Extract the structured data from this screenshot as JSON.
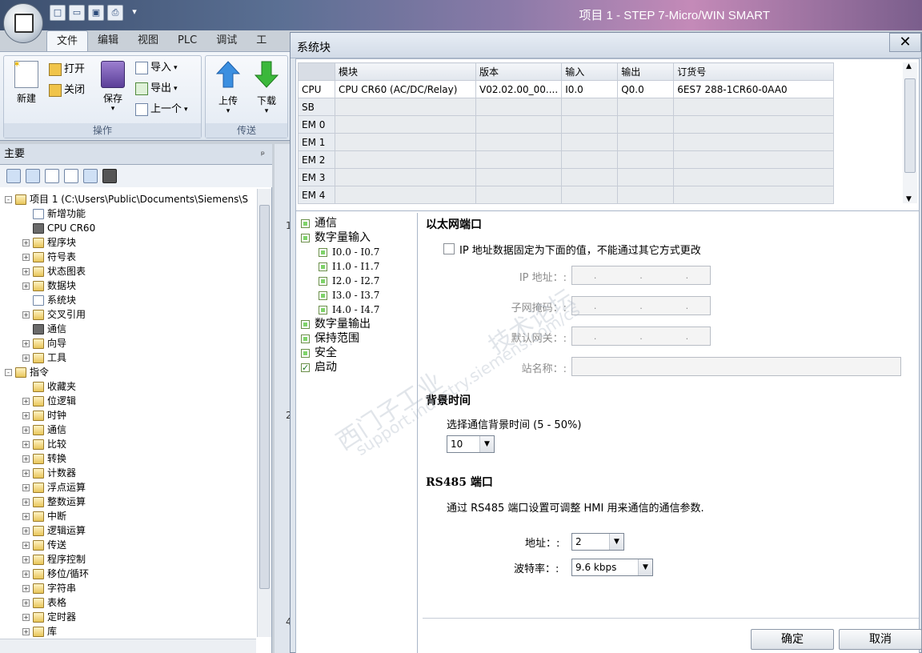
{
  "window": {
    "title": "项目 1 - STEP 7-Micro/WIN SMART"
  },
  "ribbon": {
    "tabs": [
      "文件",
      "编辑",
      "视图",
      "PLC",
      "调试",
      "工"
    ],
    "active_tab": "文件",
    "group_ops": {
      "label": "操作",
      "new": "新建",
      "open": "打开",
      "close": "关闭",
      "save": "保存",
      "import": "导入",
      "export": "导出",
      "previous": "上一个"
    },
    "group_transfer": {
      "label": "传送",
      "upload": "上传",
      "download": "下载"
    }
  },
  "left_panel": {
    "header": "主要",
    "pin": "ᵖ",
    "tree": [
      {
        "label": "项目 1 (C:\\Users\\Public\\Documents\\Siemens\\S",
        "level": 0,
        "exp": "-"
      },
      {
        "label": "新增功能",
        "level": 1,
        "exp": ""
      },
      {
        "label": "CPU CR60",
        "level": 1,
        "exp": ""
      },
      {
        "label": "程序块",
        "level": 1,
        "exp": "+"
      },
      {
        "label": "符号表",
        "level": 1,
        "exp": "+"
      },
      {
        "label": "状态图表",
        "level": 1,
        "exp": "+"
      },
      {
        "label": "数据块",
        "level": 1,
        "exp": "+"
      },
      {
        "label": "系统块",
        "level": 1,
        "exp": ""
      },
      {
        "label": "交叉引用",
        "level": 1,
        "exp": "+"
      },
      {
        "label": "通信",
        "level": 1,
        "exp": ""
      },
      {
        "label": "向导",
        "level": 1,
        "exp": "+"
      },
      {
        "label": "工具",
        "level": 1,
        "exp": "+"
      },
      {
        "label": "指令",
        "level": 0,
        "exp": "-"
      },
      {
        "label": "收藏夹",
        "level": 1,
        "exp": ""
      },
      {
        "label": "位逻辑",
        "level": 1,
        "exp": "+"
      },
      {
        "label": "时钟",
        "level": 1,
        "exp": "+"
      },
      {
        "label": "通信",
        "level": 1,
        "exp": "+"
      },
      {
        "label": "比较",
        "level": 1,
        "exp": "+"
      },
      {
        "label": "转换",
        "level": 1,
        "exp": "+"
      },
      {
        "label": "计数器",
        "level": 1,
        "exp": "+"
      },
      {
        "label": "浮点运算",
        "level": 1,
        "exp": "+"
      },
      {
        "label": "整数运算",
        "level": 1,
        "exp": "+"
      },
      {
        "label": "中断",
        "level": 1,
        "exp": "+"
      },
      {
        "label": "逻辑运算",
        "level": 1,
        "exp": "+"
      },
      {
        "label": "传送",
        "level": 1,
        "exp": "+"
      },
      {
        "label": "程序控制",
        "level": 1,
        "exp": "+"
      },
      {
        "label": "移位/循环",
        "level": 1,
        "exp": "+"
      },
      {
        "label": "字符串",
        "level": 1,
        "exp": "+"
      },
      {
        "label": "表格",
        "level": 1,
        "exp": "+"
      },
      {
        "label": "定时器",
        "level": 1,
        "exp": "+"
      },
      {
        "label": "库",
        "level": 1,
        "exp": "+"
      }
    ]
  },
  "editor": {
    "line_numbers": [
      "1",
      "2",
      "4"
    ]
  },
  "dialog": {
    "title": "系统块",
    "close": "✕",
    "table": {
      "columns": [
        "模块",
        "版本",
        "输入",
        "输出",
        "订货号"
      ],
      "rows": [
        {
          "slot": "CPU",
          "module": "CPU CR60 (AC/DC/Relay)",
          "version": "V02.02.00_00....",
          "input": "I0.0",
          "output": "Q0.0",
          "order": "6ES7 288-1CR60-0AA0"
        },
        {
          "slot": "SB",
          "module": "",
          "version": "",
          "input": "",
          "output": "",
          "order": ""
        },
        {
          "slot": "EM 0",
          "module": "",
          "version": "",
          "input": "",
          "output": "",
          "order": ""
        },
        {
          "slot": "EM 1",
          "module": "",
          "version": "",
          "input": "",
          "output": "",
          "order": ""
        },
        {
          "slot": "EM 2",
          "module": "",
          "version": "",
          "input": "",
          "output": "",
          "order": ""
        },
        {
          "slot": "EM 3",
          "module": "",
          "version": "",
          "input": "",
          "output": "",
          "order": ""
        },
        {
          "slot": "EM 4",
          "module": "",
          "version": "",
          "input": "",
          "output": "",
          "order": ""
        }
      ]
    },
    "nav": [
      {
        "label": "通信",
        "sub": false,
        "checked": false
      },
      {
        "label": "数字量输入",
        "sub": false,
        "checked": false
      },
      {
        "label": "I0.0 - I0.7",
        "sub": true,
        "checked": false
      },
      {
        "label": "I1.0 - I1.7",
        "sub": true,
        "checked": false
      },
      {
        "label": "I2.0 - I2.7",
        "sub": true,
        "checked": false
      },
      {
        "label": "I3.0 - I3.7",
        "sub": true,
        "checked": false
      },
      {
        "label": "I4.0 - I4.7",
        "sub": true,
        "checked": false
      },
      {
        "label": "数字量输出",
        "sub": false,
        "checked": false
      },
      {
        "label": "保持范围",
        "sub": false,
        "checked": false
      },
      {
        "label": "安全",
        "sub": false,
        "checked": false
      },
      {
        "label": "启动",
        "sub": false,
        "checked": true
      }
    ],
    "ethernet": {
      "title": "以太网端口",
      "fixed_ip_label": "IP 地址数据固定为下面的值，不能通过其它方式更改",
      "ip_label": "IP 地址：:",
      "subnet_label": "子网掩码：:",
      "gateway_label": "默认网关：:",
      "station_label": "站名称：:",
      "dots": "."
    },
    "background": {
      "title": "背景时间",
      "desc": "选择通信背景时间 (5 - 50%)",
      "value": "10"
    },
    "rs485": {
      "title": "RS485 端口",
      "desc": "通过 RS485 端口设置可调整 HMI 用来通信的通信参数.",
      "address_label": "地址：:",
      "address_value": "2",
      "baud_label": "波特率：:",
      "baud_value": "9.6 kbps"
    },
    "buttons": {
      "ok": "确定",
      "cancel": "取消"
    },
    "watermark": {
      "line1": "西门子工业",
      "line2": "support.industry.siemens.com/cs",
      "line3": "技术论坛"
    }
  }
}
